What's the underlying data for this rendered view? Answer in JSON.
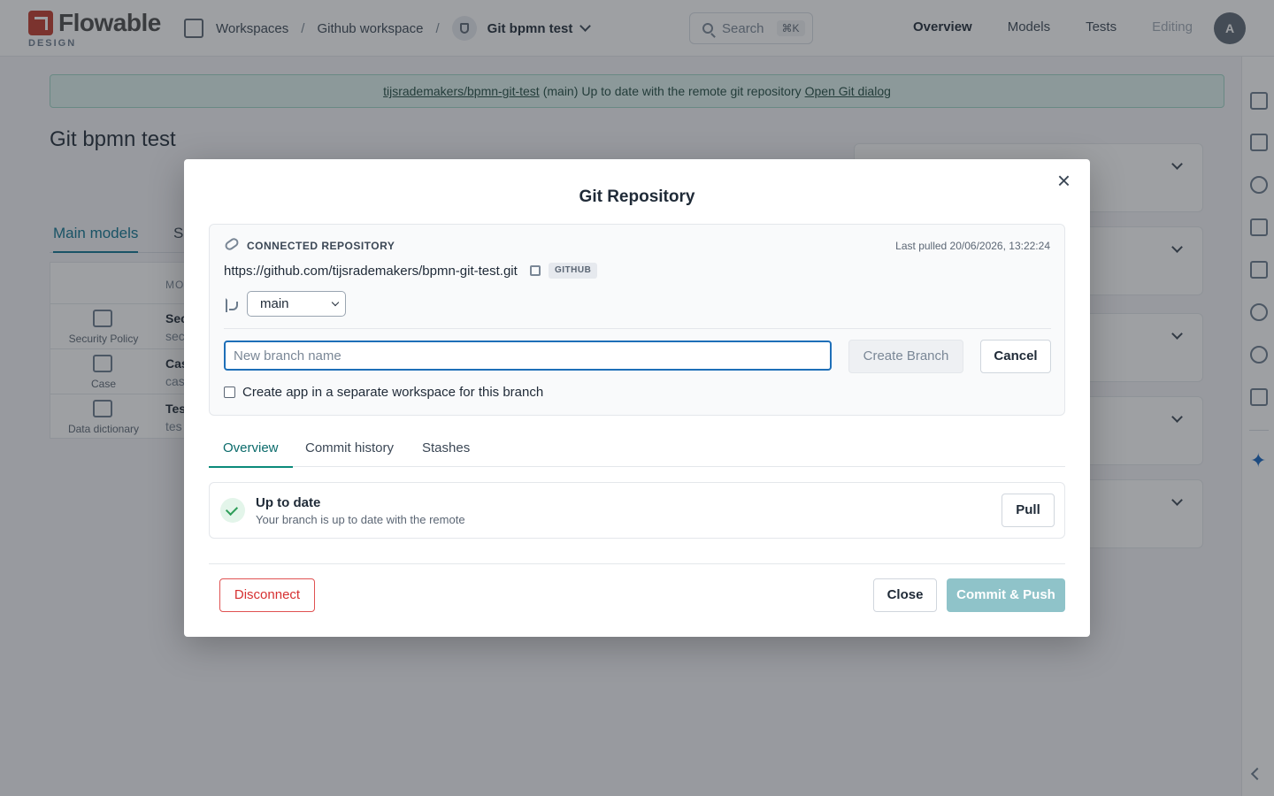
{
  "header": {
    "logo_text": "Flowable",
    "logo_sub": "DESIGN",
    "breadcrumb": [
      "Workspaces",
      "Github workspace",
      "Git bpmn test"
    ],
    "search_placeholder": "Search",
    "search_shortcut": "⌘K",
    "nav": [
      "Overview",
      "Models",
      "Tests",
      "Editing"
    ],
    "avatar": "A"
  },
  "banner": {
    "repo": "tijsrademakers/bpmn-git-test",
    "branch": "(main)",
    "status": "Up to date with the remote git repository",
    "action": "Open Git dialog"
  },
  "page": {
    "title": "Git bpmn test",
    "tabs": [
      "Main models",
      "S"
    ],
    "column_header": "MO",
    "rows": [
      {
        "icon_label": "Security Policy",
        "name": "Sec",
        "sub": "sec"
      },
      {
        "icon_label": "Case",
        "name": "Cas",
        "sub": "cas"
      },
      {
        "icon_label": "Data dictionary",
        "name": "Tes",
        "sub": "tes"
      }
    ]
  },
  "modal": {
    "title": "Git Repository",
    "repo_label": "CONNECTED REPOSITORY",
    "last_pulled": "Last pulled 20/06/2026, 13:22:24",
    "repo_url": "https://github.com/tijsrademakers/bpmn-git-test.git",
    "provider_badge": "GITHUB",
    "branch": "main",
    "branch_input_placeholder": "New branch name",
    "create_branch": "Create Branch",
    "cancel": "Cancel",
    "separate_workspace": "Create app in a separate workspace for this branch",
    "tabs": [
      "Overview",
      "Commit history",
      "Stashes"
    ],
    "status_title": "Up to date",
    "status_sub": "Your branch is up to date with the remote",
    "pull": "Pull",
    "disconnect": "Disconnect",
    "close": "Close",
    "commit_push": "Commit & Push"
  },
  "colors": {
    "accent": "#0b8a7a",
    "danger": "#d63031",
    "primary_disabled": "#8fc3c9",
    "focus": "#1e6fb8"
  }
}
